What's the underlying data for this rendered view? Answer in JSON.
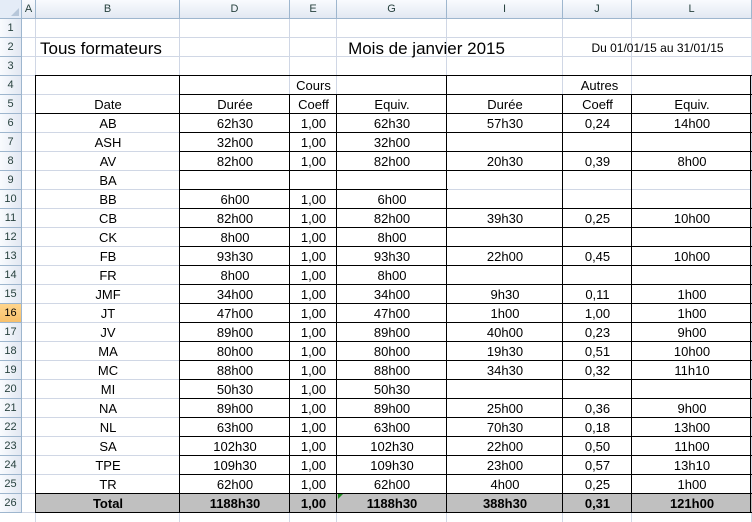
{
  "columns": [
    "A",
    "B",
    "D",
    "E",
    "G",
    "I",
    "J",
    "L"
  ],
  "selected_row": "16",
  "rows_numbers": [
    "1",
    "2",
    "3",
    "4",
    "5",
    "6",
    "7",
    "8",
    "9",
    "10",
    "11",
    "12",
    "13",
    "14",
    "15",
    "16",
    "17",
    "18",
    "19",
    "20",
    "21",
    "22",
    "23",
    "24",
    "25",
    "26"
  ],
  "header": {
    "title": "Tous formateurs",
    "month": "Mois de janvier 2015",
    "period": "Du 01/01/15 au 31/01/15",
    "group_cours": "Cours",
    "group_autres": "Autres",
    "col_date": "Date",
    "col_duree": "Durée",
    "col_coeff": "Coeff",
    "col_equiv": "Equiv."
  },
  "table_rows": [
    {
      "name": "AB",
      "d1": "62h30",
      "c1": "1,00",
      "e1": "62h30",
      "d2": "57h30",
      "c2": "0,24",
      "e2": "14h00"
    },
    {
      "name": "ASH",
      "d1": "32h00",
      "c1": "1,00",
      "e1": "32h00",
      "d2": "",
      "c2": "",
      "e2": ""
    },
    {
      "name": "AV",
      "d1": "82h00",
      "c1": "1,00",
      "e1": "82h00",
      "d2": "20h30",
      "c2": "0,39",
      "e2": "8h00"
    },
    {
      "name": "BA",
      "d1": "",
      "c1": "",
      "e1": "",
      "d2": "",
      "c2": "",
      "e2": ""
    },
    {
      "name": "BB",
      "d1": "6h00",
      "c1": "1,00",
      "e1": "6h00",
      "d2": "",
      "c2": "",
      "e2": ""
    },
    {
      "name": "CB",
      "d1": "82h00",
      "c1": "1,00",
      "e1": "82h00",
      "d2": "39h30",
      "c2": "0,25",
      "e2": "10h00"
    },
    {
      "name": "CK",
      "d1": "8h00",
      "c1": "1,00",
      "e1": "8h00",
      "d2": "",
      "c2": "",
      "e2": ""
    },
    {
      "name": "FB",
      "d1": "93h30",
      "c1": "1,00",
      "e1": "93h30",
      "d2": "22h00",
      "c2": "0,45",
      "e2": "10h00"
    },
    {
      "name": "FR",
      "d1": "8h00",
      "c1": "1,00",
      "e1": "8h00",
      "d2": "",
      "c2": "",
      "e2": ""
    },
    {
      "name": "JMF",
      "d1": "34h00",
      "c1": "1,00",
      "e1": "34h00",
      "d2": "9h30",
      "c2": "0,11",
      "e2": "1h00"
    },
    {
      "name": "JT",
      "d1": "47h00",
      "c1": "1,00",
      "e1": "47h00",
      "d2": "1h00",
      "c2": "1,00",
      "e2": "1h00"
    },
    {
      "name": "JV",
      "d1": "89h00",
      "c1": "1,00",
      "e1": "89h00",
      "d2": "40h00",
      "c2": "0,23",
      "e2": "9h00"
    },
    {
      "name": "MA",
      "d1": "80h00",
      "c1": "1,00",
      "e1": "80h00",
      "d2": "19h30",
      "c2": "0,51",
      "e2": "10h00"
    },
    {
      "name": "MC",
      "d1": "88h00",
      "c1": "1,00",
      "e1": "88h00",
      "d2": "34h30",
      "c2": "0,32",
      "e2": "11h10"
    },
    {
      "name": "MI",
      "d1": "50h30",
      "c1": "1,00",
      "e1": "50h30",
      "d2": "",
      "c2": "",
      "e2": ""
    },
    {
      "name": "NA",
      "d1": "89h00",
      "c1": "1,00",
      "e1": "89h00",
      "d2": "25h00",
      "c2": "0,36",
      "e2": "9h00"
    },
    {
      "name": "NL",
      "d1": "63h00",
      "c1": "1,00",
      "e1": "63h00",
      "d2": "70h30",
      "c2": "0,18",
      "e2": "13h00"
    },
    {
      "name": "SA",
      "d1": "102h30",
      "c1": "1,00",
      "e1": "102h30",
      "d2": "22h00",
      "c2": "0,50",
      "e2": "11h00"
    },
    {
      "name": "TPE",
      "d1": "109h30",
      "c1": "1,00",
      "e1": "109h30",
      "d2": "23h00",
      "c2": "0,57",
      "e2": "13h10"
    },
    {
      "name": "TR",
      "d1": "62h00",
      "c1": "1,00",
      "e1": "62h00",
      "d2": "4h00",
      "c2": "0,25",
      "e2": "1h00"
    }
  ],
  "total": {
    "name": "Total",
    "d1": "1188h30",
    "c1": "1,00",
    "e1": "1188h30",
    "d2": "388h30",
    "c2": "0,31",
    "e2": "121h00"
  },
  "colors": {
    "total_fill": "#c0c0c0",
    "selection": "#f7c06b",
    "gridline": "#d0d7e5",
    "marker": "#1f8a1f"
  }
}
